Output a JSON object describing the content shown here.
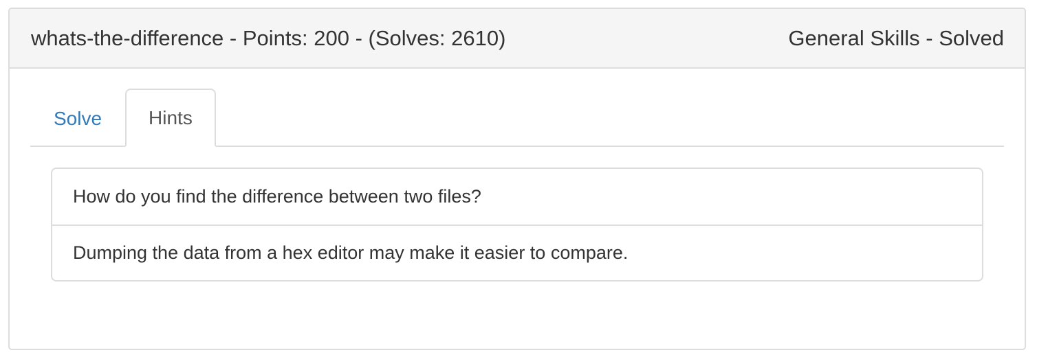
{
  "challenge": {
    "header_left": "whats-the-difference - Points: 200 - (Solves: 2610)",
    "header_right": "General Skills - Solved"
  },
  "tabs": [
    {
      "label": "Solve",
      "active": false
    },
    {
      "label": "Hints",
      "active": true
    }
  ],
  "hints": [
    "How do you find the difference between two files?",
    "Dumping the data from a hex editor may make it easier to compare."
  ],
  "colors": {
    "link": "#337ab7",
    "heading_bg": "#f5f5f5",
    "border": "#dddddd",
    "text": "#333333"
  }
}
